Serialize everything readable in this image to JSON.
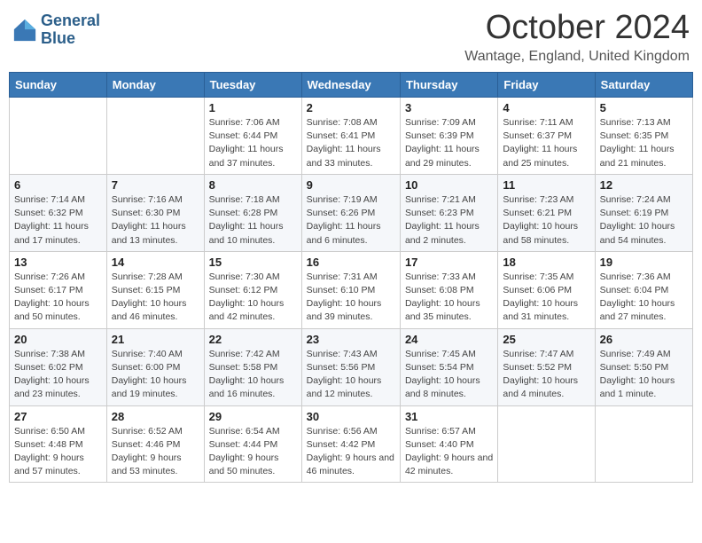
{
  "header": {
    "logo_line1": "General",
    "logo_line2": "Blue",
    "month_title": "October 2024",
    "subtitle": "Wantage, England, United Kingdom"
  },
  "weekdays": [
    "Sunday",
    "Monday",
    "Tuesday",
    "Wednesday",
    "Thursday",
    "Friday",
    "Saturday"
  ],
  "weeks": [
    [
      {
        "day": "",
        "sunrise": "",
        "sunset": "",
        "daylight": ""
      },
      {
        "day": "",
        "sunrise": "",
        "sunset": "",
        "daylight": ""
      },
      {
        "day": "1",
        "sunrise": "Sunrise: 7:06 AM",
        "sunset": "Sunset: 6:44 PM",
        "daylight": "Daylight: 11 hours and 37 minutes."
      },
      {
        "day": "2",
        "sunrise": "Sunrise: 7:08 AM",
        "sunset": "Sunset: 6:41 PM",
        "daylight": "Daylight: 11 hours and 33 minutes."
      },
      {
        "day": "3",
        "sunrise": "Sunrise: 7:09 AM",
        "sunset": "Sunset: 6:39 PM",
        "daylight": "Daylight: 11 hours and 29 minutes."
      },
      {
        "day": "4",
        "sunrise": "Sunrise: 7:11 AM",
        "sunset": "Sunset: 6:37 PM",
        "daylight": "Daylight: 11 hours and 25 minutes."
      },
      {
        "day": "5",
        "sunrise": "Sunrise: 7:13 AM",
        "sunset": "Sunset: 6:35 PM",
        "daylight": "Daylight: 11 hours and 21 minutes."
      }
    ],
    [
      {
        "day": "6",
        "sunrise": "Sunrise: 7:14 AM",
        "sunset": "Sunset: 6:32 PM",
        "daylight": "Daylight: 11 hours and 17 minutes."
      },
      {
        "day": "7",
        "sunrise": "Sunrise: 7:16 AM",
        "sunset": "Sunset: 6:30 PM",
        "daylight": "Daylight: 11 hours and 13 minutes."
      },
      {
        "day": "8",
        "sunrise": "Sunrise: 7:18 AM",
        "sunset": "Sunset: 6:28 PM",
        "daylight": "Daylight: 11 hours and 10 minutes."
      },
      {
        "day": "9",
        "sunrise": "Sunrise: 7:19 AM",
        "sunset": "Sunset: 6:26 PM",
        "daylight": "Daylight: 11 hours and 6 minutes."
      },
      {
        "day": "10",
        "sunrise": "Sunrise: 7:21 AM",
        "sunset": "Sunset: 6:23 PM",
        "daylight": "Daylight: 11 hours and 2 minutes."
      },
      {
        "day": "11",
        "sunrise": "Sunrise: 7:23 AM",
        "sunset": "Sunset: 6:21 PM",
        "daylight": "Daylight: 10 hours and 58 minutes."
      },
      {
        "day": "12",
        "sunrise": "Sunrise: 7:24 AM",
        "sunset": "Sunset: 6:19 PM",
        "daylight": "Daylight: 10 hours and 54 minutes."
      }
    ],
    [
      {
        "day": "13",
        "sunrise": "Sunrise: 7:26 AM",
        "sunset": "Sunset: 6:17 PM",
        "daylight": "Daylight: 10 hours and 50 minutes."
      },
      {
        "day": "14",
        "sunrise": "Sunrise: 7:28 AM",
        "sunset": "Sunset: 6:15 PM",
        "daylight": "Daylight: 10 hours and 46 minutes."
      },
      {
        "day": "15",
        "sunrise": "Sunrise: 7:30 AM",
        "sunset": "Sunset: 6:12 PM",
        "daylight": "Daylight: 10 hours and 42 minutes."
      },
      {
        "day": "16",
        "sunrise": "Sunrise: 7:31 AM",
        "sunset": "Sunset: 6:10 PM",
        "daylight": "Daylight: 10 hours and 39 minutes."
      },
      {
        "day": "17",
        "sunrise": "Sunrise: 7:33 AM",
        "sunset": "Sunset: 6:08 PM",
        "daylight": "Daylight: 10 hours and 35 minutes."
      },
      {
        "day": "18",
        "sunrise": "Sunrise: 7:35 AM",
        "sunset": "Sunset: 6:06 PM",
        "daylight": "Daylight: 10 hours and 31 minutes."
      },
      {
        "day": "19",
        "sunrise": "Sunrise: 7:36 AM",
        "sunset": "Sunset: 6:04 PM",
        "daylight": "Daylight: 10 hours and 27 minutes."
      }
    ],
    [
      {
        "day": "20",
        "sunrise": "Sunrise: 7:38 AM",
        "sunset": "Sunset: 6:02 PM",
        "daylight": "Daylight: 10 hours and 23 minutes."
      },
      {
        "day": "21",
        "sunrise": "Sunrise: 7:40 AM",
        "sunset": "Sunset: 6:00 PM",
        "daylight": "Daylight: 10 hours and 19 minutes."
      },
      {
        "day": "22",
        "sunrise": "Sunrise: 7:42 AM",
        "sunset": "Sunset: 5:58 PM",
        "daylight": "Daylight: 10 hours and 16 minutes."
      },
      {
        "day": "23",
        "sunrise": "Sunrise: 7:43 AM",
        "sunset": "Sunset: 5:56 PM",
        "daylight": "Daylight: 10 hours and 12 minutes."
      },
      {
        "day": "24",
        "sunrise": "Sunrise: 7:45 AM",
        "sunset": "Sunset: 5:54 PM",
        "daylight": "Daylight: 10 hours and 8 minutes."
      },
      {
        "day": "25",
        "sunrise": "Sunrise: 7:47 AM",
        "sunset": "Sunset: 5:52 PM",
        "daylight": "Daylight: 10 hours and 4 minutes."
      },
      {
        "day": "26",
        "sunrise": "Sunrise: 7:49 AM",
        "sunset": "Sunset: 5:50 PM",
        "daylight": "Daylight: 10 hours and 1 minute."
      }
    ],
    [
      {
        "day": "27",
        "sunrise": "Sunrise: 6:50 AM",
        "sunset": "Sunset: 4:48 PM",
        "daylight": "Daylight: 9 hours and 57 minutes."
      },
      {
        "day": "28",
        "sunrise": "Sunrise: 6:52 AM",
        "sunset": "Sunset: 4:46 PM",
        "daylight": "Daylight: 9 hours and 53 minutes."
      },
      {
        "day": "29",
        "sunrise": "Sunrise: 6:54 AM",
        "sunset": "Sunset: 4:44 PM",
        "daylight": "Daylight: 9 hours and 50 minutes."
      },
      {
        "day": "30",
        "sunrise": "Sunrise: 6:56 AM",
        "sunset": "Sunset: 4:42 PM",
        "daylight": "Daylight: 9 hours and 46 minutes."
      },
      {
        "day": "31",
        "sunrise": "Sunrise: 6:57 AM",
        "sunset": "Sunset: 4:40 PM",
        "daylight": "Daylight: 9 hours and 42 minutes."
      },
      {
        "day": "",
        "sunrise": "",
        "sunset": "",
        "daylight": ""
      },
      {
        "day": "",
        "sunrise": "",
        "sunset": "",
        "daylight": ""
      }
    ]
  ]
}
